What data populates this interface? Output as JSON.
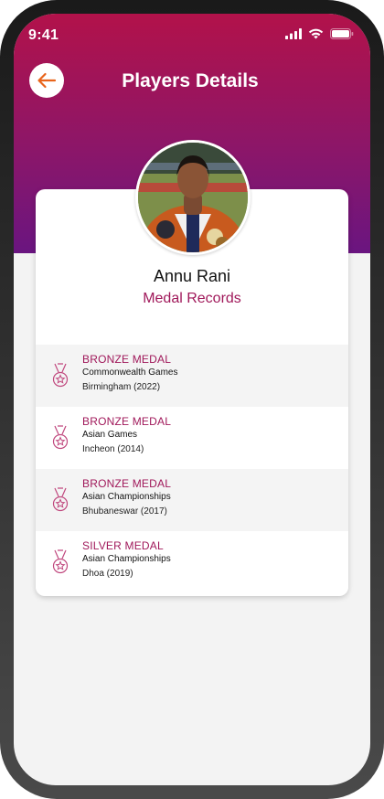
{
  "status_bar": {
    "time": "9:41"
  },
  "header": {
    "title": "Players Details",
    "back_icon": "arrow-left-icon",
    "back_icon_color": "#e8641b"
  },
  "player": {
    "name": "Annu Rani",
    "section_title": "Medal Records"
  },
  "colors": {
    "accent": "#a0185a",
    "hero_top": "#b2124a",
    "hero_bottom": "#6a1580"
  },
  "medal_records": [
    {
      "type": "BRONZE MEDAL",
      "event": "Commonwealth Games",
      "place": "Birmingham (2022)",
      "icon": "medal-icon"
    },
    {
      "type": "BRONZE MEDAL",
      "event": "Asian Games",
      "place": "Incheon (2014)",
      "icon": "medal-icon"
    },
    {
      "type": "BRONZE MEDAL",
      "event": "Asian Championships",
      "place": "Bhubaneswar (2017)",
      "icon": "medal-icon"
    },
    {
      "type": "SILVER MEDAL",
      "event": "Asian Championships",
      "place": "Dhoa (2019)",
      "icon": "medal-icon"
    }
  ]
}
